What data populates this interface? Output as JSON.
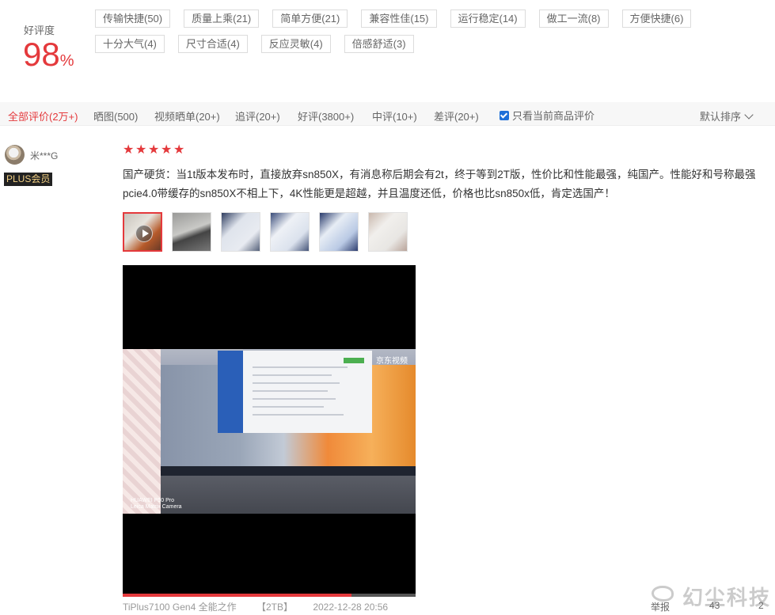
{
  "rating": {
    "label": "好评度",
    "value": "98",
    "unit": "%"
  },
  "tags": [
    "传输快捷(50)",
    "质量上乘(21)",
    "简单方便(21)",
    "兼容性佳(15)",
    "运行稳定(14)",
    "做工一流(8)",
    "方便快捷(6)",
    "十分大气(4)",
    "尺寸合适(4)",
    "反应灵敏(4)",
    "倍感舒适(3)"
  ],
  "filter": {
    "tabs": [
      {
        "label": "全部评价(2万+)",
        "active": true
      },
      {
        "label": "晒图(500)"
      },
      {
        "label": "视频晒单(20+)"
      },
      {
        "label": "追评(20+)"
      },
      {
        "label": "好评(3800+)"
      },
      {
        "label": "中评(10+)"
      },
      {
        "label": "差评(20+)"
      }
    ],
    "only_current_label": "只看当前商品评价",
    "only_current_checked": true,
    "sort_label": "默认排序"
  },
  "review": {
    "user_name": "米***G",
    "badge": "PLUS会员",
    "stars": 5,
    "content": "国产硬货：当1t版本发布时，直接放弃sn850X，有消息称后期会有2t，终于等到2T版，性价比和性能最强，纯国产。性能好和号称最强pcie4.0带缓存的sn850X不相上下，4K性能更是超越，并且温度还低，价格也比sn850x低，肯定选国产！",
    "thumb_count": 6,
    "video": {
      "overlay_brand": "京东视频",
      "camera_text": "HUAWEI P50 Pro\nLeica Matrix Camera",
      "progress": 0.78
    },
    "product": "TiPlus7100 Gen4 全能之作",
    "capacity": "【2TB】",
    "date": "2022-12-28 20:56",
    "report_label": "举报",
    "like_count": "43",
    "comment_count": "2"
  },
  "watermark": "幻尘科技",
  "colors": {
    "accent": "#e4393c",
    "plus_bg": "#222222",
    "plus_text": "#f4d184"
  }
}
